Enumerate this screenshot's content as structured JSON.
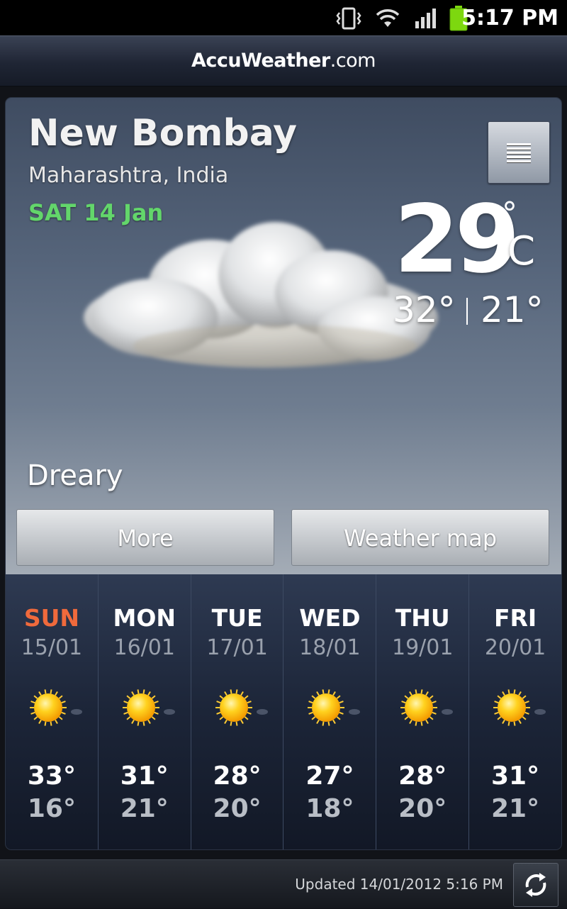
{
  "status_bar": {
    "time": "5:17 PM",
    "icons": [
      "vibrate-icon",
      "wifi-icon",
      "signal-icon",
      "battery-icon"
    ],
    "battery_color": "#7dd80f"
  },
  "header": {
    "brand_main": "AccuWeather",
    "brand_domain": ".com"
  },
  "current": {
    "city": "New Bombay",
    "region": "Maharashtra, India",
    "date": "SAT 14 Jan",
    "temperature": "29",
    "degree_symbol": "°",
    "unit": "C",
    "high": "32°",
    "low": "21°",
    "condition": "Dreary",
    "icon": "cloud-icon"
  },
  "buttons": {
    "more": "More",
    "weather_map": "Weather map"
  },
  "forecast": [
    {
      "day": "SUN",
      "date": "15/01",
      "high": "33°",
      "low": "16°",
      "icon": "sun-icon"
    },
    {
      "day": "MON",
      "date": "16/01",
      "high": "31°",
      "low": "21°",
      "icon": "sun-icon"
    },
    {
      "day": "TUE",
      "date": "17/01",
      "high": "28°",
      "low": "20°",
      "icon": "sun-icon"
    },
    {
      "day": "WED",
      "date": "18/01",
      "high": "27°",
      "low": "18°",
      "icon": "sun-icon"
    },
    {
      "day": "THU",
      "date": "19/01",
      "high": "28°",
      "low": "20°",
      "icon": "sun-icon"
    },
    {
      "day": "FRI",
      "date": "20/01",
      "high": "31°",
      "low": "21°",
      "icon": "sun-icon"
    }
  ],
  "colors": {
    "date_green": "#63d66b",
    "sunday_orange": "#f06a3c"
  },
  "footer": {
    "updated": "Updated 14/01/2012 5:16 PM"
  }
}
